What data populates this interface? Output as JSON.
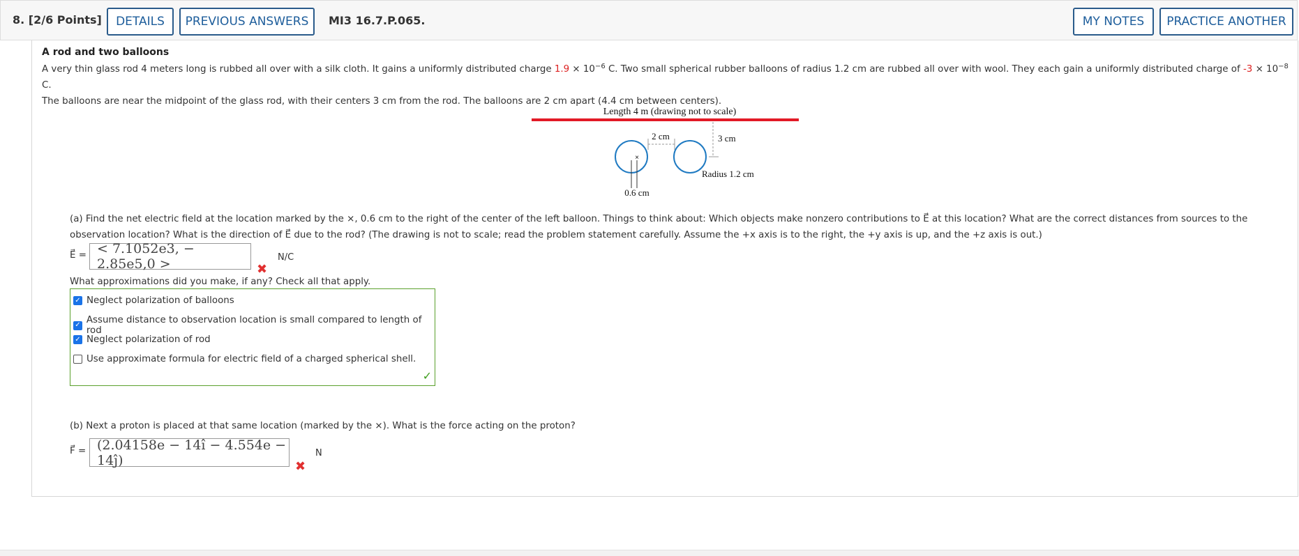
{
  "header": {
    "question_number": "8.",
    "points": "[2/6 Points]",
    "details_label": "DETAILS",
    "previous_answers_label": "PREVIOUS ANSWERS",
    "problem_code": "MI3 16.7.P.065.",
    "my_notes_label": "MY NOTES",
    "practice_another_label": "PRACTICE ANOTHER"
  },
  "problem": {
    "title": "A rod and two balloons",
    "para1_a": "A very thin glass rod 4 meters long is rubbed all over with a silk cloth. It gains a uniformly distributed charge ",
    "rod_charge_mantissa": "1.9",
    "rod_charge_times": " × 10",
    "rod_charge_exp": "−6",
    "para1_b": " C. Two small spherical rubber balloons of radius 1.2 cm are rubbed all over with wool. They each gain a uniformly distributed charge of ",
    "balloon_charge_mantissa": "-3",
    "balloon_charge_times": " × 10",
    "balloon_charge_exp": "−8",
    "para1_c": " C.",
    "para2": "The balloons are near the midpoint of the glass rod, with their centers 3 cm from the rod. The balloons are 2 cm apart (4.4 cm between centers)."
  },
  "diagram": {
    "rod_label": "Length 4 m (drawing not to scale)",
    "gap_label": "2 cm",
    "distance_label": "3 cm",
    "radius_label": "Radius 1.2 cm",
    "offset_label": "0.6 cm",
    "marker": "×",
    "rod_color": "#e21a26",
    "balloon_color": "#1f7ac2"
  },
  "part_a": {
    "question_1": "(a) Find the net electric field at the location marked by the ×, 0.6 cm to the right of the center of the left balloon. Things to think about: Which objects make nonzero contributions to ",
    "question_2": " at this location? What are the correct distances from sources to the",
    "question_3": "observation location? What is the direction of ",
    "question_4": " due to the rod? (The drawing is not to scale; read the problem statement carefully. Assume the +x axis is to the right, the +y axis is up, and the +z axis is out.)",
    "e_symbol": "E⃗",
    "answer_label": "E⃗ =",
    "answer_value": "< 7.1052e3, − 2.85e5,0 >",
    "unit": "N/C",
    "approx_question": "What approximations did you make, if any? Check all that apply.",
    "options": [
      {
        "label": "Neglect polarization of balloons",
        "checked": true
      },
      {
        "label": "Assume distance to observation location is small compared to length of rod",
        "checked": true
      },
      {
        "label": "Neglect polarization of rod",
        "checked": true
      },
      {
        "label": "Use approximate formula for electric field of a charged spherical shell.",
        "checked": false
      }
    ],
    "check_symbol": "✓",
    "incorrect_symbol": "✖"
  },
  "part_b": {
    "question": "(b) Next a proton is placed at that same location (marked by the ×). What is the force acting on the proton?",
    "answer_label": "F⃗ =",
    "answer_value": "(2.04158e − 14î − 4.554e − 14ĵ)",
    "unit": "N",
    "incorrect_symbol": "✖"
  }
}
